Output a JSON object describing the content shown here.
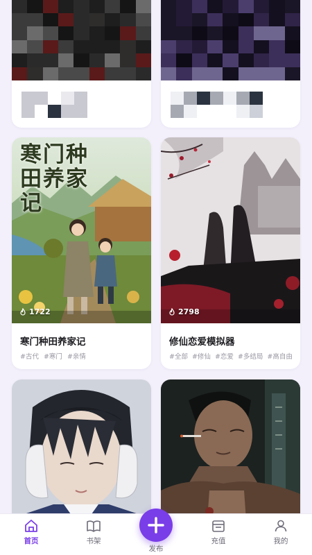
{
  "colors": {
    "accent": "#7a3ee8",
    "background": "#f3f0fb"
  },
  "feed": {
    "cards": [
      {
        "id": "c1",
        "title": "",
        "heat": "",
        "tags": [],
        "blurred": true
      },
      {
        "id": "c2",
        "title": "",
        "heat": "",
        "tags": [],
        "blurred": true
      },
      {
        "id": "c3",
        "title": "寒门种田养家记",
        "cover_text": "寒门种田养家记",
        "heat": "1722",
        "tags": [
          "#古代",
          "#寒门",
          "#亲情"
        ]
      },
      {
        "id": "c4",
        "title": "修仙恋爱模拟器",
        "heat": "2798",
        "tags": [
          "#全部",
          "#修仙",
          "#恋爱",
          "#多结局",
          "#高自由"
        ]
      },
      {
        "id": "c5",
        "title": "",
        "heat": "",
        "tags": []
      },
      {
        "id": "c6",
        "title": "",
        "heat": "",
        "tags": []
      }
    ]
  },
  "nav": {
    "home": "首页",
    "bookshelf": "书架",
    "publish": "发布",
    "recharge": "充值",
    "me": "我的"
  },
  "icons": {
    "heat": "fire-icon",
    "home": "home-icon",
    "bookshelf": "book-icon",
    "publish": "plus-icon",
    "recharge": "wallet-icon",
    "me": "user-icon"
  }
}
